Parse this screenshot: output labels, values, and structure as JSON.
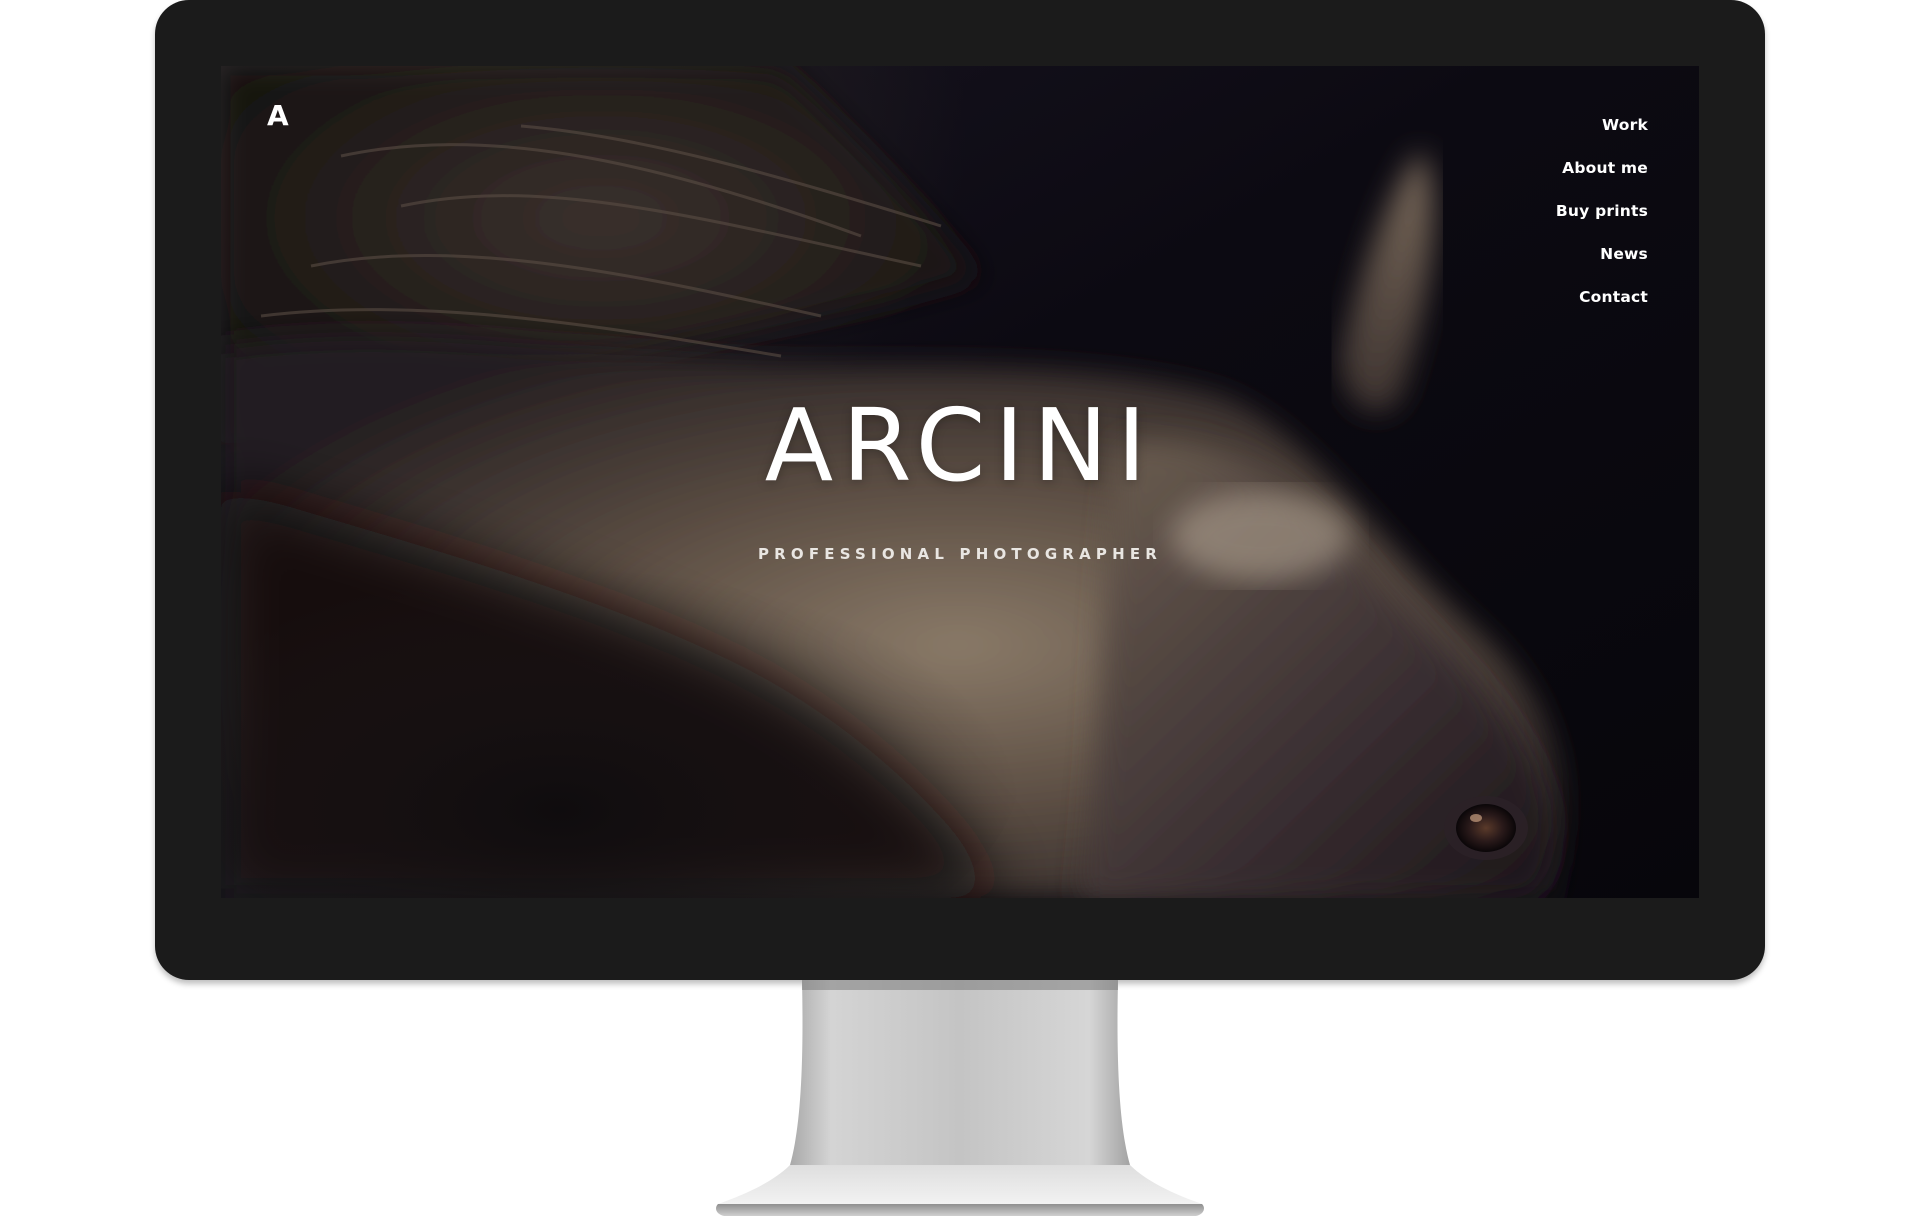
{
  "site": {
    "logo_text": "A",
    "title": "ARCINI",
    "subtitle": "PROFESSIONAL PHOTOGRAPHER"
  },
  "nav": {
    "items": [
      {
        "label": "Work"
      },
      {
        "label": "About me"
      },
      {
        "label": "Buy prints"
      },
      {
        "label": "News"
      },
      {
        "label": "Contact"
      }
    ]
  },
  "colors": {
    "bezel": "#1b1b1b",
    "screen_background": "#0c0a12",
    "text": "#ffffff",
    "stand": "#c9c9c9"
  }
}
